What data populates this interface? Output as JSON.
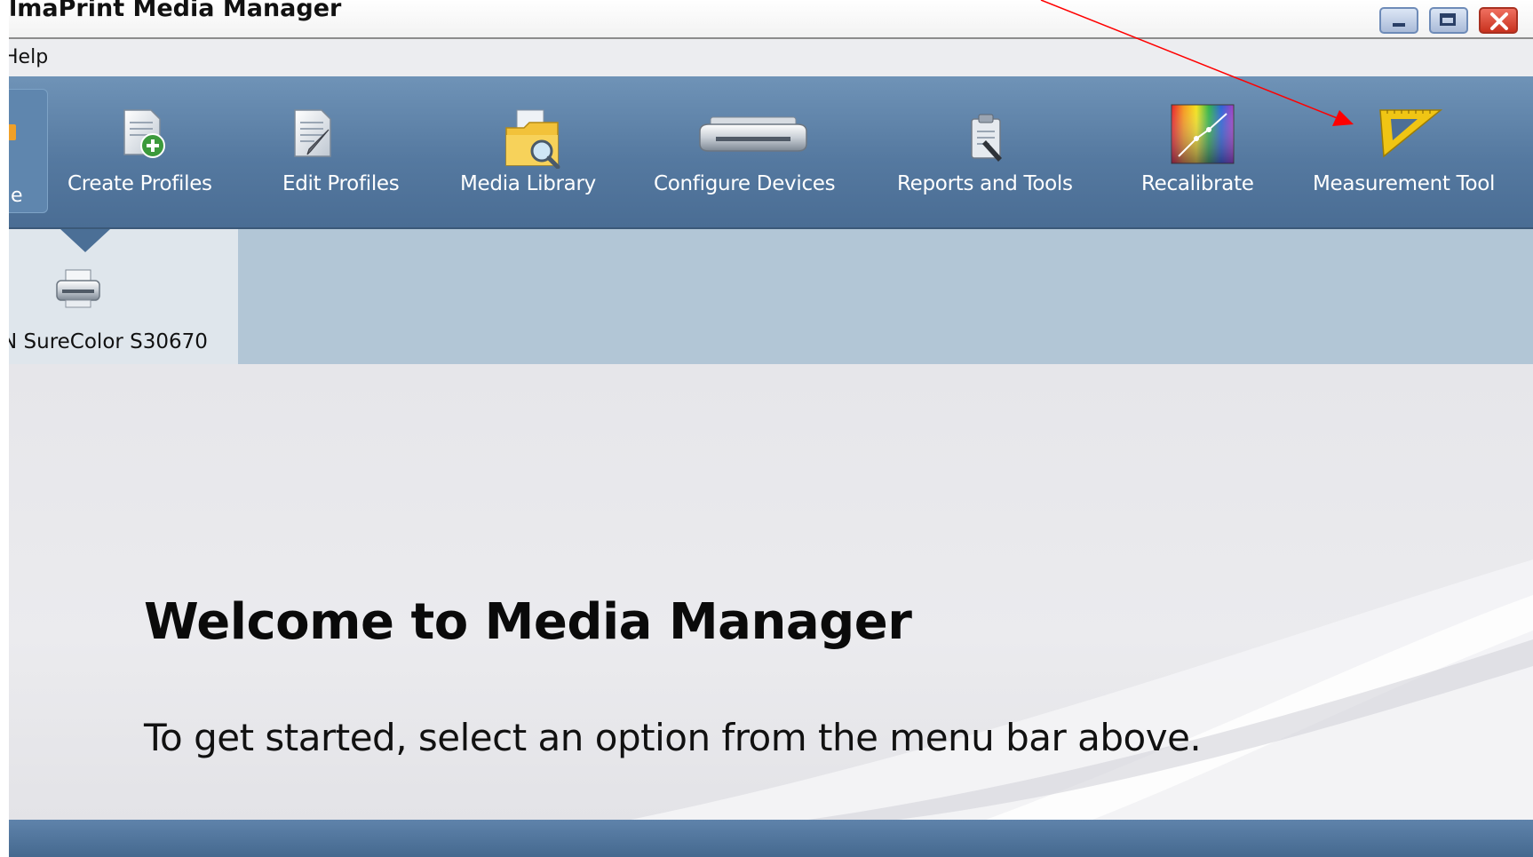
{
  "window": {
    "title": "lmaPrint Media Manager",
    "controls": [
      "minimize",
      "maximize",
      "close"
    ]
  },
  "menubar": {
    "items": [
      {
        "label": "Help"
      }
    ]
  },
  "toolbar": {
    "home_label": "e",
    "items": [
      {
        "label": "Create Profiles",
        "icon": "create-profile-icon"
      },
      {
        "label": "Edit Profiles",
        "icon": "edit-profile-icon"
      },
      {
        "label": "Media Library",
        "icon": "media-library-icon"
      },
      {
        "label": "Configure Devices",
        "icon": "printer-icon"
      },
      {
        "label": "Reports and Tools",
        "icon": "clipboard-icon"
      },
      {
        "label": "Recalibrate",
        "icon": "color-chart-icon"
      },
      {
        "label": "Measurement Tool",
        "icon": "set-square-icon"
      }
    ]
  },
  "devices": {
    "selected": {
      "label": "N SureColor S30670",
      "icon": "printer-icon"
    }
  },
  "main": {
    "title": "Welcome to Media Manager",
    "subtitle": "To get started, select an option from the menu bar above."
  },
  "colors": {
    "toolbar": "#5579a0",
    "device_bar": "#b2c6d6",
    "annotation_arrow": "#ff0000"
  }
}
